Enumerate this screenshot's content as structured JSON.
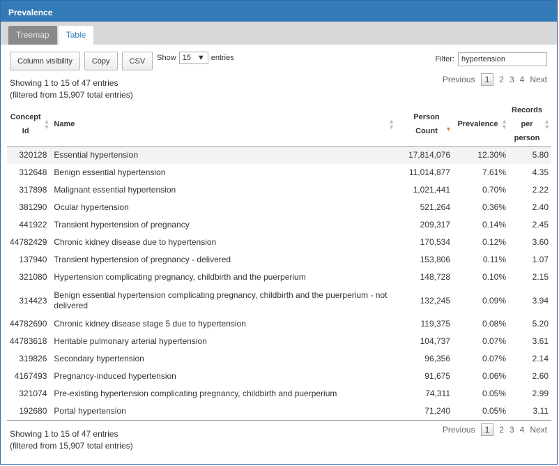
{
  "panel": {
    "title": "Prevalence"
  },
  "tabs": [
    {
      "label": "Treemap",
      "active": false
    },
    {
      "label": "Table",
      "active": true
    }
  ],
  "toolbar": {
    "column_visibility_label": "Column visibility",
    "copy_label": "Copy",
    "csv_label": "CSV",
    "show_label": "Show",
    "entries_value": "15",
    "entries_label": "entries"
  },
  "filter": {
    "label": "Filter:",
    "value": "hypertension"
  },
  "info": {
    "line1": "Showing 1 to 15 of 47 entries",
    "line2": "(filtered from 15,907 total entries)"
  },
  "pager": {
    "previous": "Previous",
    "pages": [
      "1",
      "2",
      "3",
      "4"
    ],
    "current": "1",
    "next": "Next"
  },
  "table": {
    "columns": [
      "Concept Id",
      "Name",
      "Person Count",
      "Prevalence",
      "Records per person"
    ],
    "sorted_column": "Person Count",
    "sort_direction": "descending",
    "rows": [
      [
        "320128",
        "Essential hypertension",
        "17,814,076",
        "12.30%",
        "5.80"
      ],
      [
        "312648",
        "Benign essential hypertension",
        "11,014,877",
        "7.61%",
        "4.35"
      ],
      [
        "317898",
        "Malignant essential hypertension",
        "1,021,441",
        "0.70%",
        "2.22"
      ],
      [
        "381290",
        "Ocular hypertension",
        "521,264",
        "0.36%",
        "2.40"
      ],
      [
        "441922",
        "Transient hypertension of pregnancy",
        "209,317",
        "0.14%",
        "2.45"
      ],
      [
        "44782429",
        "Chronic kidney disease due to hypertension",
        "170,534",
        "0.12%",
        "3.60"
      ],
      [
        "137940",
        "Transient hypertension of pregnancy - delivered",
        "153,806",
        "0.11%",
        "1.07"
      ],
      [
        "321080",
        "Hypertension complicating pregnancy, childbirth and the puerperium",
        "148,728",
        "0.10%",
        "2.15"
      ],
      [
        "314423",
        "Benign essential hypertension complicating pregnancy, childbirth and the puerperium - not delivered",
        "132,245",
        "0.09%",
        "3.94"
      ],
      [
        "44782690",
        "Chronic kidney disease stage 5 due to hypertension",
        "119,375",
        "0.08%",
        "5.20"
      ],
      [
        "44783618",
        "Heritable pulmonary arterial hypertension",
        "104,737",
        "0.07%",
        "3.61"
      ],
      [
        "319826",
        "Secondary hypertension",
        "96,356",
        "0.07%",
        "2.14"
      ],
      [
        "4167493",
        "Pregnancy-induced hypertension",
        "91,675",
        "0.06%",
        "2.60"
      ],
      [
        "321074",
        "Pre-existing hypertension complicating pregnancy, childbirth and puerperium",
        "74,311",
        "0.05%",
        "2.99"
      ],
      [
        "192680",
        "Portal hypertension",
        "71,240",
        "0.05%",
        "3.11"
      ]
    ]
  }
}
